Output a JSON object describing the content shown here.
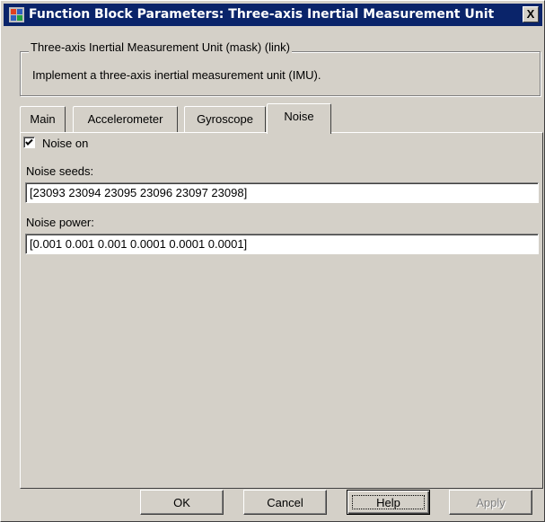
{
  "window": {
    "title": "Function Block Parameters: Three-axis Inertial Measurement Unit",
    "close_glyph": "X"
  },
  "mask": {
    "group_title": "Three-axis Inertial Measurement Unit (mask) (link)",
    "description": "Implement a three-axis inertial measurement unit (IMU)."
  },
  "tabs": [
    {
      "label": "Main",
      "active": false
    },
    {
      "label": "Accelerometer",
      "active": false
    },
    {
      "label": "Gyroscope",
      "active": false
    },
    {
      "label": "Noise",
      "active": true
    }
  ],
  "noise": {
    "noise_on_label": "Noise on",
    "noise_on_checked": true,
    "seeds_label": "Noise seeds:",
    "seeds_value": "[23093 23094 23095 23096 23097 23098]",
    "power_label": "Noise power:",
    "power_value": "[0.001 0.001 0.001 0.0001 0.0001 0.0001]"
  },
  "buttons": {
    "ok": "OK",
    "cancel": "Cancel",
    "help": "Help",
    "apply": "Apply"
  },
  "colors": {
    "titlebar": "#0a246a",
    "face": "#d4d0c8"
  }
}
